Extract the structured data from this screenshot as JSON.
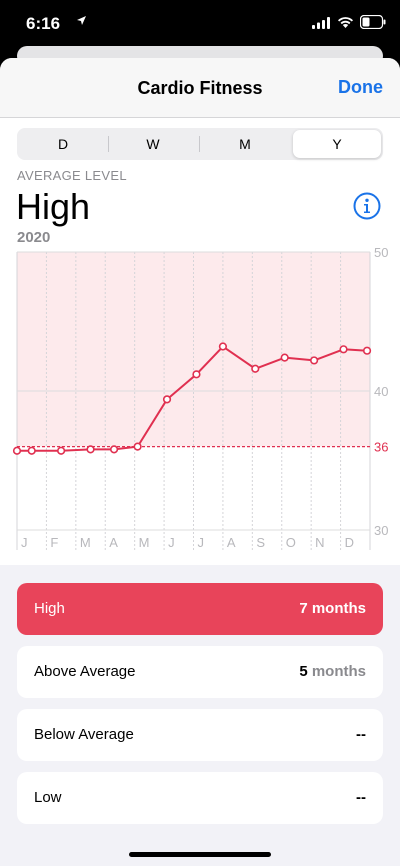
{
  "status_bar": {
    "time": "6:16"
  },
  "navbar": {
    "title": "Cardio Fitness",
    "done_label": "Done"
  },
  "segments": [
    {
      "label": "D",
      "selected": false
    },
    {
      "label": "W",
      "selected": false
    },
    {
      "label": "M",
      "selected": false
    },
    {
      "label": "Y",
      "selected": true
    }
  ],
  "summary": {
    "heading": "AVERAGE LEVEL",
    "value": "High",
    "period": "2020"
  },
  "chart_data": {
    "type": "line",
    "categories": [
      "J",
      "F",
      "M",
      "A",
      "M",
      "J",
      "J",
      "A",
      "S",
      "O",
      "N",
      "D"
    ],
    "series": [
      {
        "x": [
          0,
          0.5,
          1.5,
          2.5,
          3.3,
          4.1,
          5.1,
          6.1,
          7.0,
          8.1,
          9.1,
          10.1,
          11.1,
          11.9
        ],
        "values": [
          35.7,
          35.7,
          35.7,
          35.8,
          35.8,
          36.0,
          39.4,
          41.2,
          43.2,
          41.6,
          42.4,
          42.2,
          43.0,
          42.9
        ]
      }
    ],
    "ylim": [
      30,
      50
    ],
    "yticks": [
      {
        "value": 50,
        "label": "50"
      },
      {
        "value": 40,
        "label": "40"
      },
      {
        "value": 30,
        "label": "30"
      }
    ],
    "threshold": {
      "value": 36,
      "label": "36"
    },
    "high_band": [
      36,
      50
    ],
    "colors": {
      "line": "#e03050",
      "band": "#fdeaec",
      "threshold_label": "#e03050"
    }
  },
  "stats": [
    {
      "label": "High",
      "count": "7",
      "unit": "months",
      "highlighted": true
    },
    {
      "label": "Above Average",
      "count": "5",
      "unit": "months",
      "highlighted": false
    },
    {
      "label": "Below Average",
      "count": "--",
      "unit": "",
      "highlighted": false
    },
    {
      "label": "Low",
      "count": "--",
      "unit": "",
      "highlighted": false
    }
  ]
}
